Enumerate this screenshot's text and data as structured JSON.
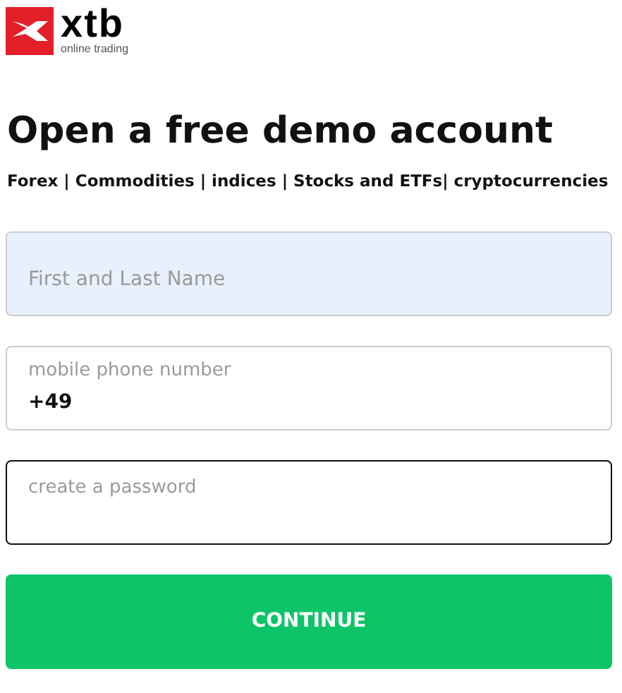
{
  "logo": {
    "wordmark": "xtb",
    "tagline": "online trading"
  },
  "title": "Open a free demo account",
  "subtitle": "Forex | Commodities | indices | Stocks and ETFs| cryptocurrencies",
  "fields": [
    {
      "kind": "plain",
      "placeholder": "First and Last Name",
      "autofilled": true,
      "focused": false
    },
    {
      "kind": "floating",
      "label": "mobile phone number",
      "value": "+49",
      "autofilled": false,
      "focused": false
    },
    {
      "kind": "floating",
      "label": "create a password",
      "autofilled": false,
      "focused": true
    }
  ],
  "button": "CONTINUE"
}
